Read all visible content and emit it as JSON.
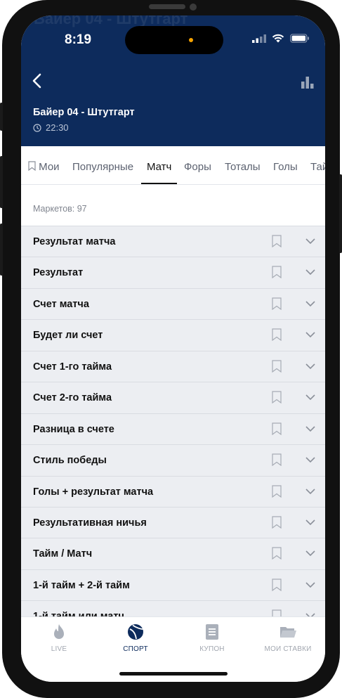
{
  "status_bar": {
    "time": "8:19"
  },
  "header": {
    "match_title": "Байер 04 - Штутгарт",
    "match_time": "22:30",
    "back_icon": "chevron-left-icon",
    "stats_icon": "bar-chart-icon"
  },
  "tabs": [
    {
      "label": "Мои"
    },
    {
      "label": "Популярные"
    },
    {
      "label": "Матч"
    },
    {
      "label": "Форы"
    },
    {
      "label": "Тоталы"
    },
    {
      "label": "Голы"
    },
    {
      "label": "Тай"
    }
  ],
  "active_tab": "Матч",
  "markets_count": "Маркетов: 97",
  "markets": [
    {
      "label": "Результат матча"
    },
    {
      "label": "Результат"
    },
    {
      "label": "Счет матча"
    },
    {
      "label": "Будет ли счет"
    },
    {
      "label": "Счет 1-го тайма"
    },
    {
      "label": "Счет 2-го тайма"
    },
    {
      "label": "Разница в счете"
    },
    {
      "label": "Стиль победы"
    },
    {
      "label": "Голы + результат матча"
    },
    {
      "label": "Результативная ничья"
    },
    {
      "label": "Тайм / Матч"
    },
    {
      "label": "1-й тайм + 2-й тайм"
    },
    {
      "label": "1-й тайм или матч"
    }
  ],
  "bottom_nav": [
    {
      "label": "LIVE",
      "icon": "flame-icon"
    },
    {
      "label": "СПОРТ",
      "icon": "ball-icon"
    },
    {
      "label": "КУПОН",
      "icon": "coupon-icon"
    },
    {
      "label": "МОИ СТАВКИ",
      "icon": "folder-icon"
    }
  ],
  "active_nav": "СПОРТ",
  "colors": {
    "header_bg": "#0d2b5c",
    "list_bg": "#eceef2",
    "accent": "#0d2b5c"
  }
}
